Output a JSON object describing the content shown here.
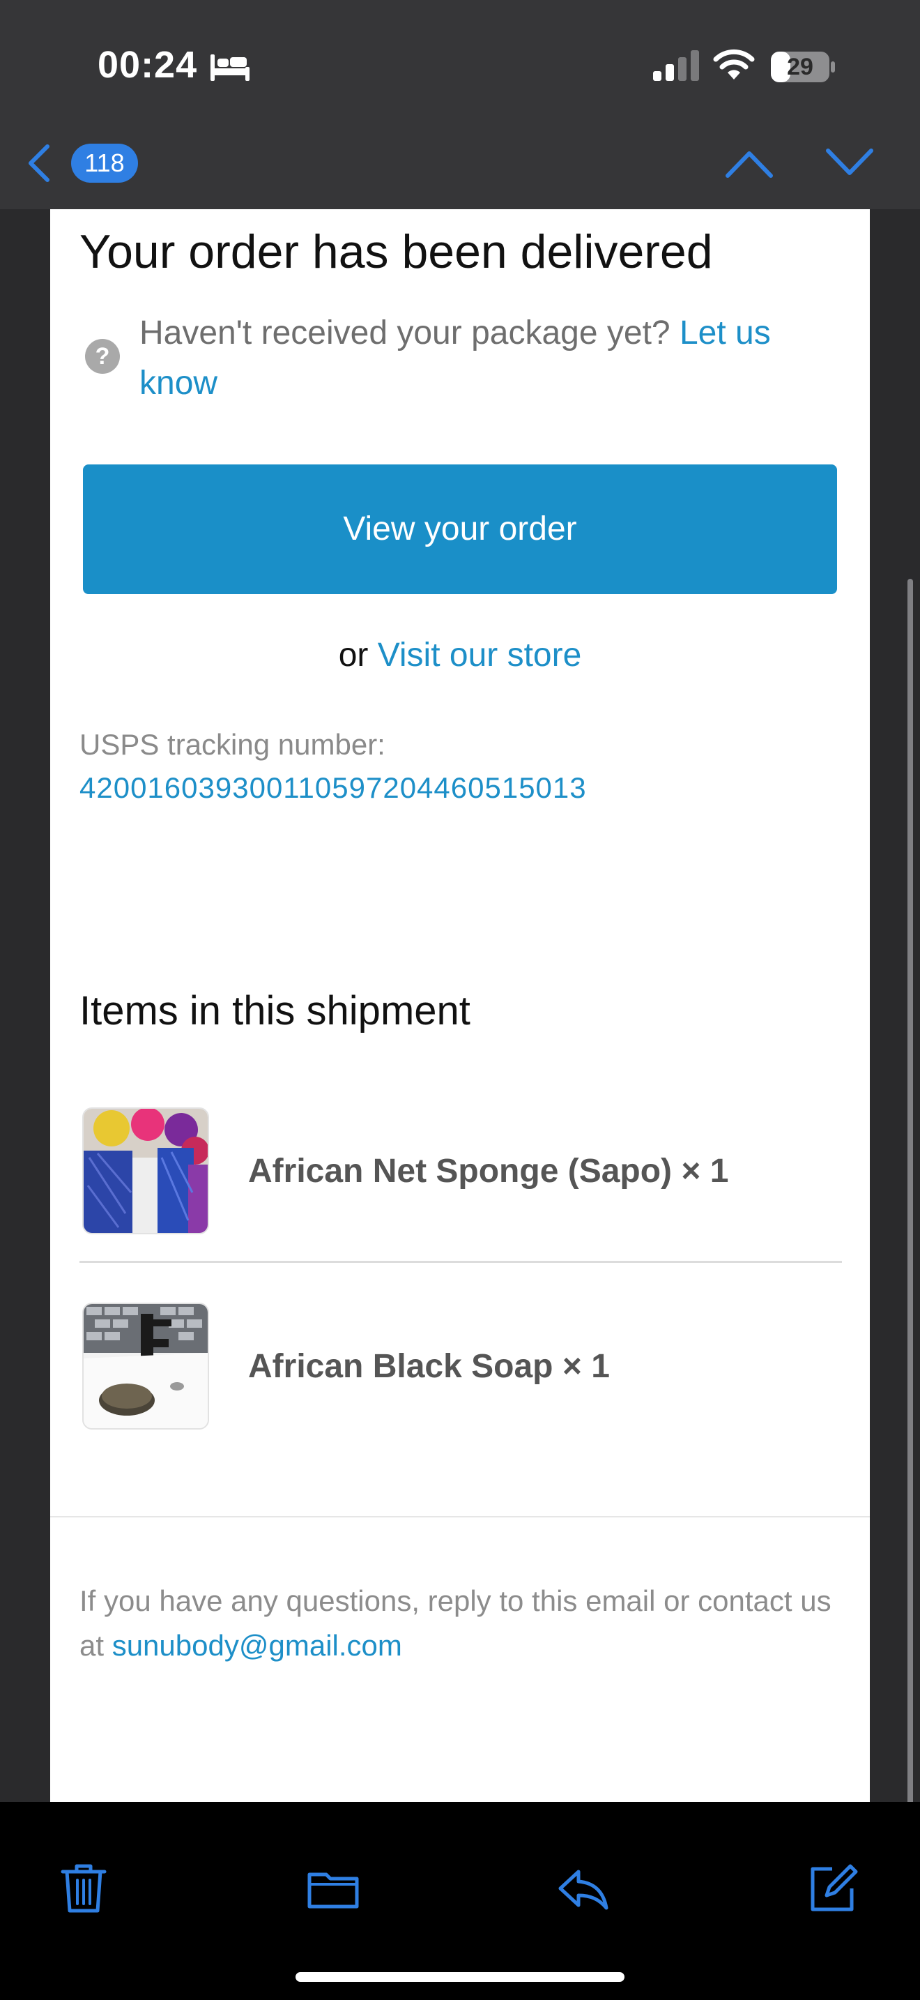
{
  "status_bar": {
    "time": "00:24",
    "battery_level": "29",
    "icons": [
      "bed-icon",
      "cellular-signal-icon",
      "wifi-icon",
      "battery-icon"
    ]
  },
  "mail_nav": {
    "back_icon": "chevron-left-icon",
    "unread_count": "118",
    "previous_icon": "chevron-up-icon",
    "next_icon": "chevron-down-icon"
  },
  "email": {
    "heading": "Your order has been delivered",
    "help": {
      "text": "Haven't received your package yet? ",
      "link": "Let us know",
      "icon": "question-circle-icon"
    },
    "view_order_button": "View your order",
    "store_prefix": "or ",
    "store_link": "Visit our store",
    "tracking_label": "USPS tracking number:",
    "tracking_number": "420016039300110597204460515013",
    "items_heading": "Items in this shipment",
    "items": [
      {
        "name": "African Net Sponge (Sapo) × 1"
      },
      {
        "name": "African Black Soap × 1"
      }
    ],
    "footer_text": "If you have any questions, reply to this email or contact us at ",
    "footer_email": "sunubody@gmail.com"
  },
  "toolbar": {
    "icons": [
      "trash-icon",
      "folder-icon",
      "reply-icon",
      "compose-icon"
    ]
  },
  "colors": {
    "accent_blue": "#1a8fc8",
    "ios_blue": "#2f7fe3",
    "nav_background": "#363638"
  }
}
